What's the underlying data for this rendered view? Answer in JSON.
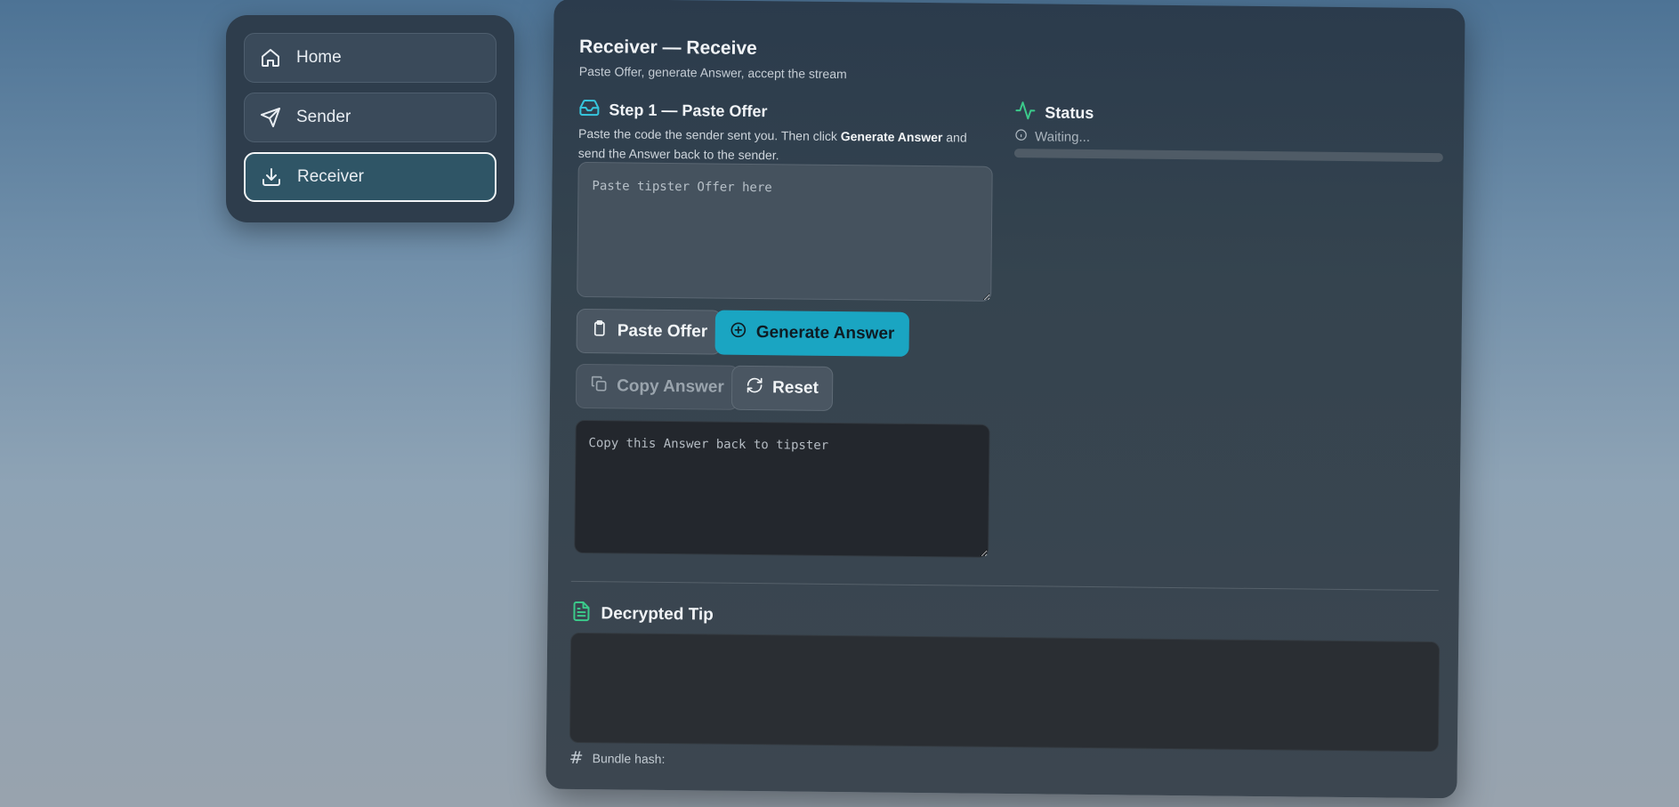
{
  "sidebar": {
    "items": [
      {
        "label": "Home",
        "icon": "home-icon",
        "active": false
      },
      {
        "label": "Sender",
        "icon": "send-icon",
        "active": false
      },
      {
        "label": "Receiver",
        "icon": "download-icon",
        "active": true
      }
    ]
  },
  "panel": {
    "title": "Receiver — Receive",
    "subtitle": "Paste Offer, generate Answer, accept the stream"
  },
  "step1": {
    "title": "Step 1 — Paste Offer",
    "desc_prefix": "Paste the code the sender sent you. Then click ",
    "desc_bold": "Generate Answer",
    "desc_suffix": " and send the Answer back to the sender.",
    "offer_placeholder": "Paste tipster Offer here",
    "offer_value": ""
  },
  "buttons": {
    "paste_offer": "Paste Offer",
    "generate_answer": "Generate Answer",
    "copy_answer": "Copy Answer",
    "reset": "Reset"
  },
  "answer": {
    "placeholder": "Copy this Answer back to tipster",
    "value": ""
  },
  "status": {
    "title": "Status",
    "text": "Waiting...",
    "progress": 0
  },
  "decrypted": {
    "title": "Decrypted Tip",
    "content": ""
  },
  "bundle_hash": {
    "label": "Bundle hash:",
    "value": ""
  },
  "colors": {
    "accent": "#1aa5c2",
    "status_green": "#3bc98a",
    "step_icon": "#36c5dc"
  }
}
